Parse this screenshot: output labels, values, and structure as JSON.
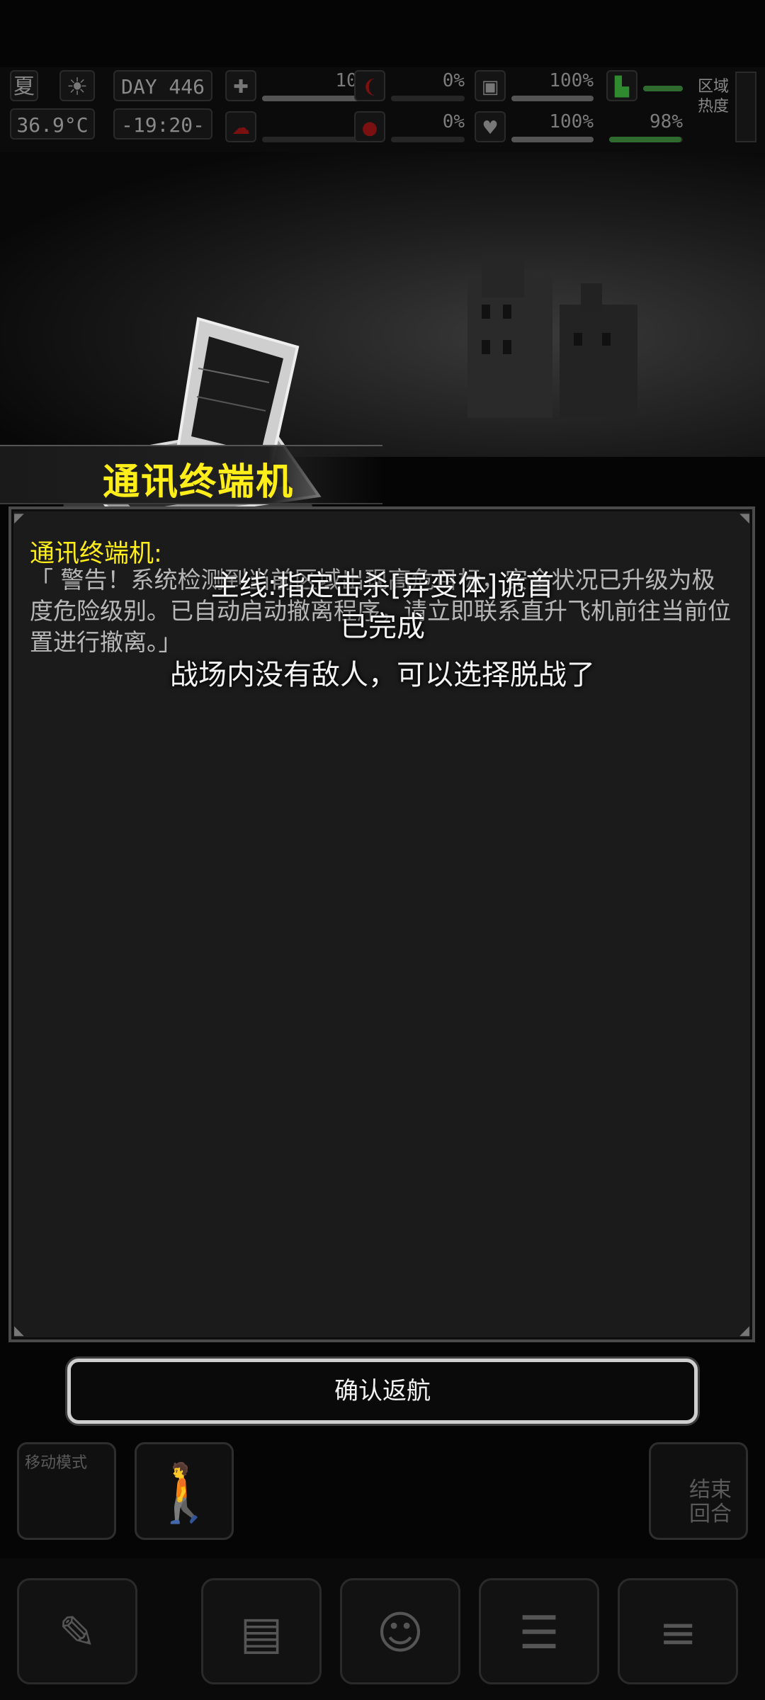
{
  "hud": {
    "season": "夏",
    "temperature": "36.9°C",
    "day_label": "DAY",
    "day_number": "446",
    "time": "-19:20-",
    "stats": [
      {
        "name": "medkit",
        "value": "100%",
        "level": 1.0
      },
      {
        "name": "hunger",
        "value": "0%",
        "level": 0.0
      },
      {
        "name": "stamina",
        "value": "100%",
        "level": 1.0
      },
      {
        "name": "brain",
        "value": "0%",
        "level": 0.0
      },
      {
        "name": "blood",
        "value": "0%",
        "level": 0.0
      },
      {
        "name": "health",
        "value": "100%",
        "level": 1.0
      },
      {
        "name": "leg",
        "value": "98%",
        "level": 0.98
      }
    ],
    "region_heat_label": "区域热度"
  },
  "title": "通讯终端机",
  "dialog": {
    "speaker": "通讯终端机:",
    "message": "「 警告！系统检测到当前区域出现高危目标，安全状况已升级为极度危险级别。已自动启动撤离程序，请立即联系直升飞机前往当前位置进行撤离。」"
  },
  "toasts": {
    "mission_line1": "主线:指定击杀[异变体]诡首",
    "mission_line2": "已完成",
    "battle": "战场内没有敌人，可以选择脱战了"
  },
  "confirm_button": "确认返航",
  "controls": {
    "move_mode_label": "移动模式",
    "end_turn_label": "结束回合"
  }
}
